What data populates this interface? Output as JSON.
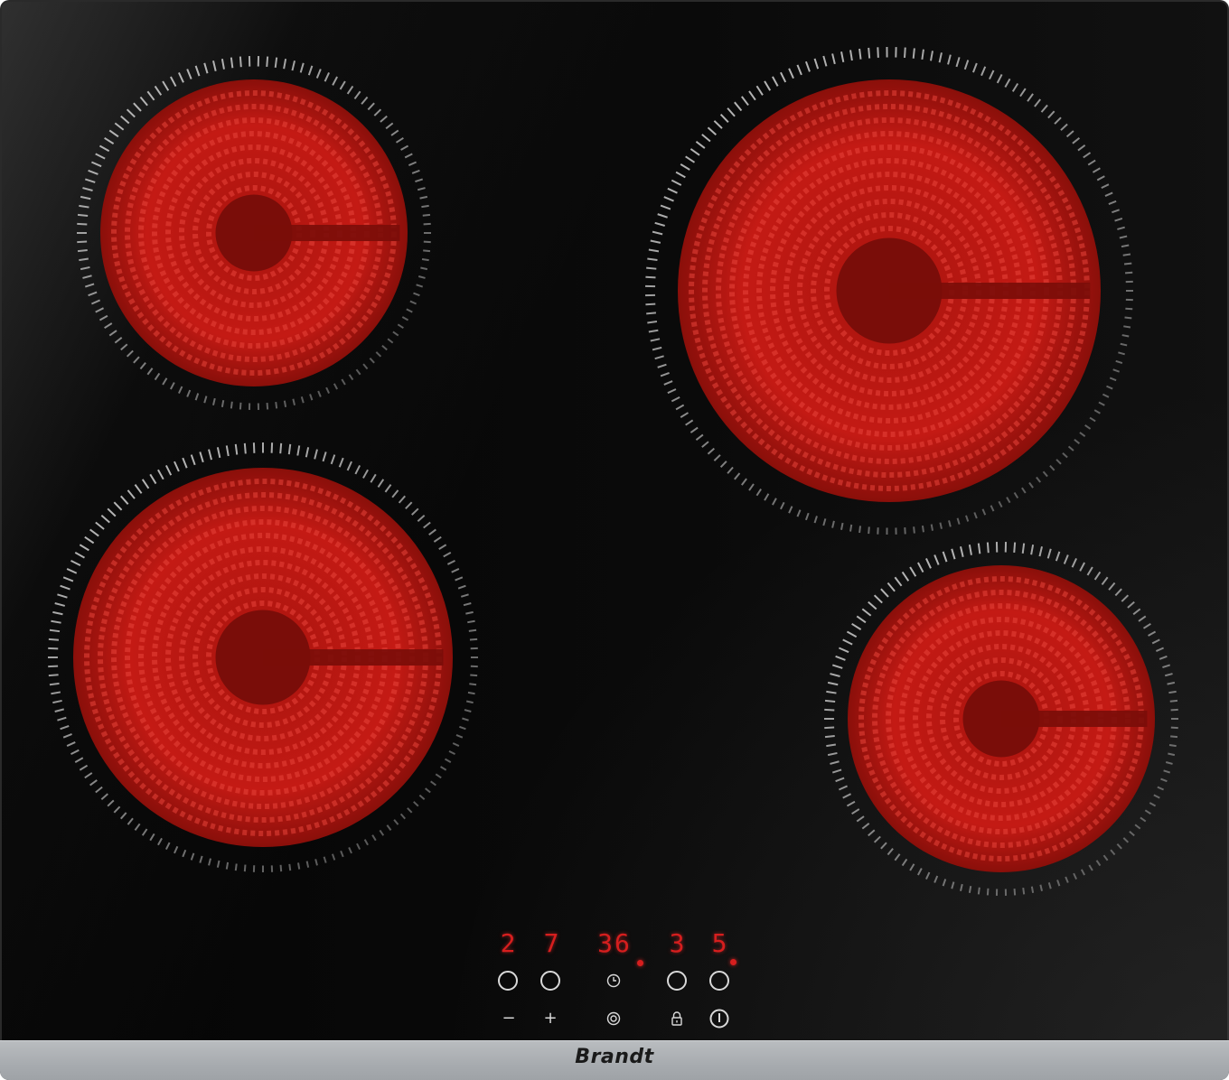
{
  "brand": "Brandt",
  "displays": {
    "zone_left_minus": "2",
    "zone_left_plus": "7",
    "timer": "36",
    "zone_right_a": "3",
    "zone_right_b": "5"
  },
  "controls": {
    "minus_symbol": "−",
    "plus_symbol": "+",
    "timer_icon": "clock-icon",
    "zone_select_icon": "target-icon",
    "lock_icon": "lock-icon",
    "power_icon": "power-icon"
  },
  "colors": {
    "glass": "#050505",
    "heating_element": "#c41a14",
    "display_red": "#d61e1e",
    "trim": "#a7abaf"
  },
  "zones": [
    {
      "name": "cooking-zone-rear-left"
    },
    {
      "name": "cooking-zone-front-left"
    },
    {
      "name": "cooking-zone-rear-right"
    },
    {
      "name": "cooking-zone-front-right"
    }
  ]
}
